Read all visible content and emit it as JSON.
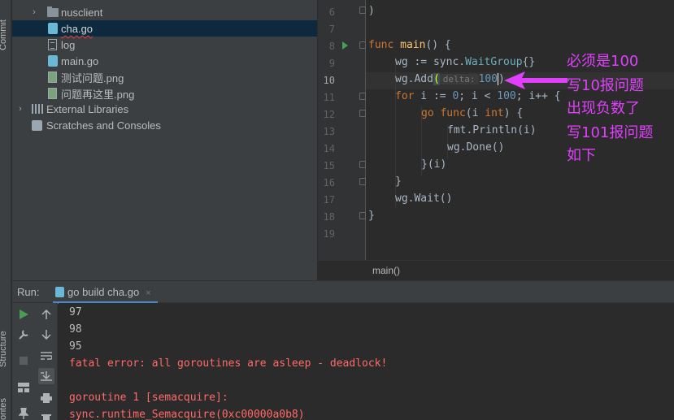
{
  "side_strip": {
    "top_label": "Commit",
    "structure_label": "Structure",
    "favorites_label": "orites"
  },
  "project_tree": [
    {
      "label": "nusclient",
      "icon": "folder-icon",
      "expandable": true
    },
    {
      "label": "cha.go",
      "icon": "go-file-icon",
      "selected": true
    },
    {
      "label": "log",
      "icon": "file-icon"
    },
    {
      "label": "main.go",
      "icon": "go-file-icon"
    },
    {
      "label": "测试问题.png",
      "icon": "image-file-icon"
    },
    {
      "label": "问题再这里.png",
      "icon": "image-file-icon"
    },
    {
      "label": "External Libraries",
      "icon": "library-icon",
      "expandable": true
    },
    {
      "label": "Scratches and Consoles",
      "icon": "scratches-icon"
    }
  ],
  "editor": {
    "line_numbers": [
      "6",
      "7",
      "8",
      "9",
      "10",
      "11",
      "12",
      "13",
      "14",
      "15",
      "16",
      "17",
      "18",
      "19"
    ],
    "active_line": "10",
    "code": {
      "l6": ")",
      "l8_kw": "func",
      "l8_name": "main",
      "l8_rest": "() {",
      "l9_a": "wg := sync.",
      "l9_b": "WaitGroup",
      "l9_c": "{}",
      "l10_a": "wg.Add",
      "l10_paren": "(",
      "l10_hint": "delta:",
      "l10_val": "100",
      "l10_close": ")",
      "l11_kw": "for",
      "l11_a": " i := ",
      "l11_n0": "0",
      "l11_b": "; i < ",
      "l11_n100": "100",
      "l11_c": "; i++ {",
      "l12_kw": "go",
      "l12_kw2": "func",
      "l12_a": "(i ",
      "l12_type": "int",
      "l12_b": ") {",
      "l13": "fmt.Println(i)",
      "l14": "wg.Done()",
      "l15": "}(i)",
      "l16": "}",
      "l17": "wg.Wait()",
      "l18": "}"
    }
  },
  "breadcrumb": "main()",
  "annotation": {
    "lines": [
      "必须是100",
      "写10报问题",
      "出现负数了",
      "写101报问题",
      "如下"
    ],
    "color": "#e040fb"
  },
  "run_panel": {
    "label": "Run:",
    "tab_label": "go build cha.go",
    "tab_close": "×",
    "console_lines": [
      {
        "text": "97",
        "error": false
      },
      {
        "text": "98",
        "error": false
      },
      {
        "text": "95",
        "error": false
      },
      {
        "text": "fatal error: all goroutines are asleep - deadlock!",
        "error": true
      },
      {
        "text": "",
        "error": false
      },
      {
        "text": "goroutine 1 [semacquire]:",
        "error": true
      },
      {
        "text": "sync.runtime_Semacquire(0xc00000a0b8)",
        "error": true
      }
    ]
  },
  "colors": {
    "keyword": "#cc7832",
    "function": "#ffc66d",
    "number": "#6897bb",
    "error_text": "#ff6b68",
    "selection": "#0d293e"
  }
}
